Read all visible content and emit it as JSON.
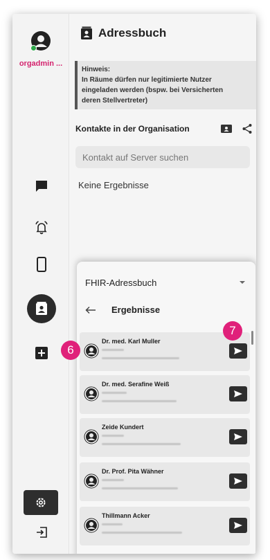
{
  "user": {
    "name": "orgadmin ..."
  },
  "header": {
    "title": "Adressbuch"
  },
  "notice": {
    "line1": "Hinweis:",
    "line2": "In Räume dürfen nur legitimierte Nutzer",
    "line3": "eingeladen werden (bspw. bei Versicherten",
    "line4": "deren Stellvertreter)"
  },
  "contacts": {
    "title": "Kontakte in der Organisation",
    "search_placeholder": "Kontakt auf Server suchen",
    "empty": "Keine Ergebnisse"
  },
  "sheet": {
    "selected_addressbook": "FHIR-Adressbuch",
    "results_title": "Ergebnisse",
    "results": [
      {
        "name": "Dr. med. Karl Muller"
      },
      {
        "name": "Dr. med. Serafine Weiß"
      },
      {
        "name": "Zeide Kundert"
      },
      {
        "name": "Dr. Prof. Pita Wähner"
      },
      {
        "name": "Thillmann Acker"
      }
    ]
  },
  "markers": {
    "m6": "6",
    "m7": "7"
  },
  "icons": {
    "nav": [
      "chat-icon",
      "alarm-bell-icon",
      "phone-icon",
      "contacts-icon",
      "add-icon",
      "settings-icon",
      "logout-icon"
    ],
    "header": "contacts-book-icon",
    "send": "send-icon"
  },
  "colors": {
    "accent": "#d4246e",
    "marker": "#e0217a",
    "online": "#2ea84a",
    "dark_button": "#2e2e2e"
  }
}
